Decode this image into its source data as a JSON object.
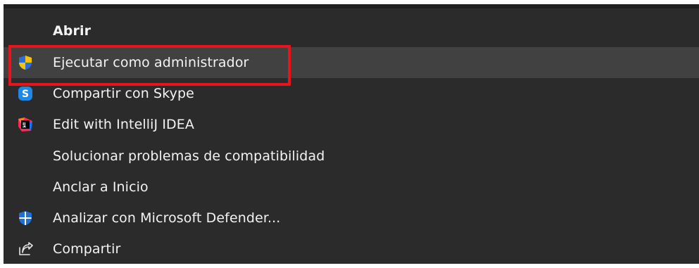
{
  "context_menu": {
    "items": [
      {
        "label": "Abrir",
        "icon": "none",
        "bold": true
      },
      {
        "label": "Ejecutar como administrador",
        "icon": "uac-shield-icon",
        "hovered": true
      },
      {
        "label": "Compartir con Skype",
        "icon": "skype-icon"
      },
      {
        "label": "Edit with IntelliJ IDEA",
        "icon": "intellij-idea-icon"
      },
      {
        "label": "Solucionar problemas de compatibilidad",
        "icon": "none"
      },
      {
        "label": "Anclar a Inicio",
        "icon": "none"
      },
      {
        "label": "Analizar con Microsoft Defender...",
        "icon": "defender-shield-icon"
      },
      {
        "label": "Compartir",
        "icon": "share-icon"
      }
    ],
    "highlight_color": "#e8141c",
    "background_color": "#2b2b2b",
    "hover_color": "#414141"
  }
}
